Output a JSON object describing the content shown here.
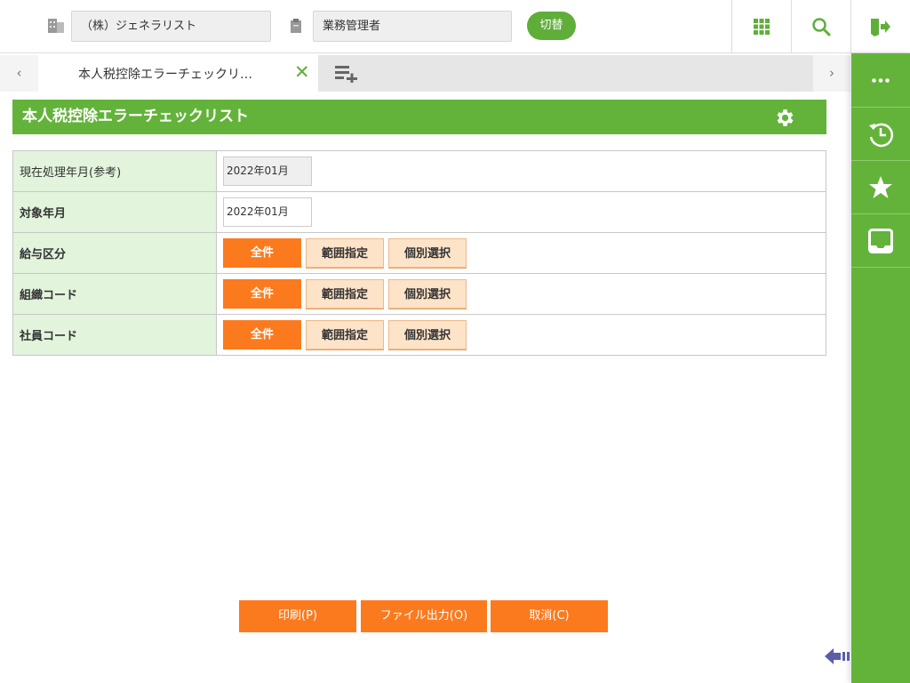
{
  "header": {
    "company": "（株）ジェネラリスト",
    "role": "業務管理者",
    "switch_label": "切替"
  },
  "tabs": {
    "active_label": "本人税控除エラーチェックリ…"
  },
  "page": {
    "title": "本人税控除エラーチェックリスト"
  },
  "form": {
    "rows": [
      {
        "label": "現在処理年月(参考)",
        "value": "2022年01月"
      },
      {
        "label": "対象年月",
        "value": "2022年01月"
      },
      {
        "label": "給与区分"
      },
      {
        "label": "組織コード"
      },
      {
        "label": "社員コード"
      }
    ],
    "options": {
      "all": "全件",
      "range": "範囲指定",
      "select": "個別選択"
    }
  },
  "footer": {
    "print": "印刷(P)",
    "export": "ファイル出力(O)",
    "cancel": "取消(C)"
  },
  "colors": {
    "green": "#63b33a",
    "orange": "#fc7a1e"
  }
}
